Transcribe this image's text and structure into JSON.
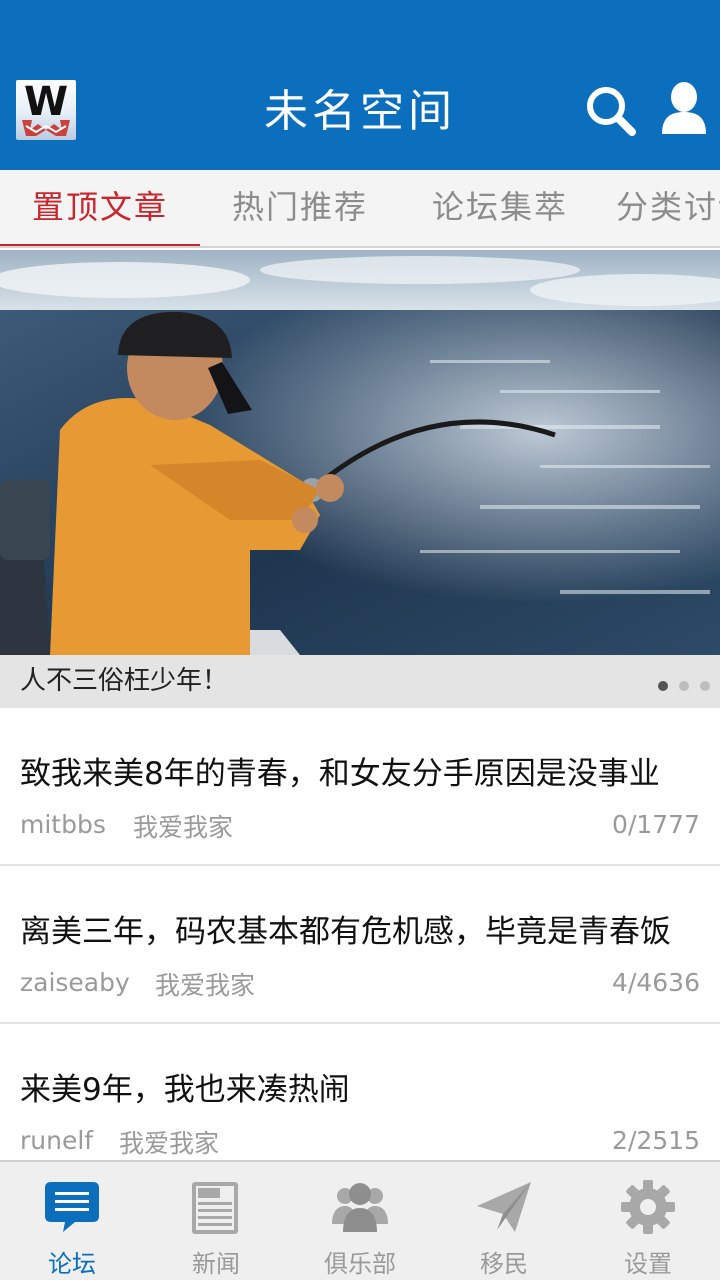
{
  "header": {
    "title": "未名空间",
    "logo_text": "W",
    "colors": {
      "bar": "#0c6fbd",
      "active_tab": "#c8252c"
    },
    "icons": {
      "search": "search-icon",
      "profile": "user-icon"
    }
  },
  "tabs": [
    {
      "label": "置顶文章",
      "active": true
    },
    {
      "label": "热门推荐"
    },
    {
      "label": "论坛集萃"
    },
    {
      "label": "分类讨论"
    }
  ],
  "banner": {
    "caption": "人不三俗枉少年！",
    "slide_count": 3,
    "active_slide": 1
  },
  "posts": [
    {
      "title": "致我来美8年的青春，和女友分手原因是没事业",
      "author": "mitbbs",
      "board": "我爱我家",
      "count": "0/1777"
    },
    {
      "title": "离美三年，码农基本都有危机感，毕竟是青春饭",
      "author": "zaiseaby",
      "board": "我爱我家",
      "count": "4/4636"
    },
    {
      "title": "来美9年，我也来凑热闹",
      "author": "runelf",
      "board": "我爱我家",
      "count": "2/2515"
    }
  ],
  "bottom_nav": [
    {
      "label": "论坛",
      "icon": "chat-bubble-icon",
      "active": true
    },
    {
      "label": "新闻",
      "icon": "newspaper-icon"
    },
    {
      "label": "俱乐部",
      "icon": "group-icon"
    },
    {
      "label": "移民",
      "icon": "paper-plane-icon"
    },
    {
      "label": "设置",
      "icon": "gear-icon"
    }
  ]
}
